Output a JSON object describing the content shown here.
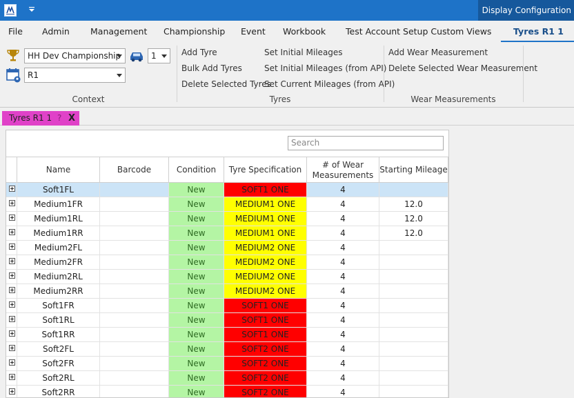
{
  "titlebar": {
    "display_config": "Display Configuration"
  },
  "menu": {
    "tabs": [
      {
        "label": "File"
      },
      {
        "label": "Admin"
      },
      {
        "label": "Management"
      },
      {
        "label": "Championship"
      },
      {
        "label": "Event"
      },
      {
        "label": "Workbook"
      },
      {
        "label": "Test Account Setup Custom Views"
      },
      {
        "label": "Tyres R1 1",
        "active": true
      }
    ]
  },
  "context": {
    "championship": "HH Dev Championship",
    "car": "1",
    "event": "R1",
    "group_label": "Context"
  },
  "tyres_group": {
    "col1": [
      "Add Tyre",
      "Bulk Add Tyres",
      "Delete Selected Tyres"
    ],
    "col2": [
      "Set Initial Mileages",
      "Set Initial Mileages (from API)",
      "Set Current Mileages (from API)"
    ],
    "group_label": "Tyres"
  },
  "wear_group": {
    "items": [
      "Add Wear Measurement",
      "Delete Selected Wear Measurement"
    ],
    "group_label": "Wear Measurements"
  },
  "doc_tab": {
    "title": "Tyres R1 1",
    "help": "?",
    "close": "X"
  },
  "grid": {
    "search_placeholder": "Search",
    "columns": [
      "Name",
      "Barcode",
      "Condition",
      "Tyre Specification",
      "# of Wear Measurements",
      "Starting Mileage"
    ],
    "rows": [
      {
        "name": "Soft1FL",
        "barcode": "",
        "condition": "New",
        "spec": "SOFT1 ONE",
        "spec_type": "soft",
        "wear": "4",
        "mileage": "",
        "selected": true
      },
      {
        "name": "Medium1FR",
        "barcode": "",
        "condition": "New",
        "spec": "MEDIUM1 ONE",
        "spec_type": "medium",
        "wear": "4",
        "mileage": "12.0"
      },
      {
        "name": "Medium1RL",
        "barcode": "",
        "condition": "New",
        "spec": "MEDIUM1 ONE",
        "spec_type": "medium",
        "wear": "4",
        "mileage": "12.0"
      },
      {
        "name": "Medium1RR",
        "barcode": "",
        "condition": "New",
        "spec": "MEDIUM1 ONE",
        "spec_type": "medium",
        "wear": "4",
        "mileage": "12.0"
      },
      {
        "name": "Medium2FL",
        "barcode": "",
        "condition": "New",
        "spec": "MEDIUM2 ONE",
        "spec_type": "medium",
        "wear": "4",
        "mileage": ""
      },
      {
        "name": "Medium2FR",
        "barcode": "",
        "condition": "New",
        "spec": "MEDIUM2 ONE",
        "spec_type": "medium",
        "wear": "4",
        "mileage": ""
      },
      {
        "name": "Medium2RL",
        "barcode": "",
        "condition": "New",
        "spec": "MEDIUM2 ONE",
        "spec_type": "medium",
        "wear": "4",
        "mileage": ""
      },
      {
        "name": "Medium2RR",
        "barcode": "",
        "condition": "New",
        "spec": "MEDIUM2 ONE",
        "spec_type": "medium",
        "wear": "4",
        "mileage": ""
      },
      {
        "name": "Soft1FR",
        "barcode": "",
        "condition": "New",
        "spec": "SOFT1 ONE",
        "spec_type": "soft",
        "wear": "4",
        "mileage": ""
      },
      {
        "name": "Soft1RL",
        "barcode": "",
        "condition": "New",
        "spec": "SOFT1 ONE",
        "spec_type": "soft",
        "wear": "4",
        "mileage": ""
      },
      {
        "name": "Soft1RR",
        "barcode": "",
        "condition": "New",
        "spec": "SOFT1 ONE",
        "spec_type": "soft",
        "wear": "4",
        "mileage": ""
      },
      {
        "name": "Soft2FL",
        "barcode": "",
        "condition": "New",
        "spec": "SOFT2 ONE",
        "spec_type": "soft",
        "wear": "4",
        "mileage": ""
      },
      {
        "name": "Soft2FR",
        "barcode": "",
        "condition": "New",
        "spec": "SOFT2 ONE",
        "spec_type": "soft",
        "wear": "4",
        "mileage": ""
      },
      {
        "name": "Soft2RL",
        "barcode": "",
        "condition": "New",
        "spec": "SOFT2 ONE",
        "spec_type": "soft",
        "wear": "4",
        "mileage": ""
      },
      {
        "name": "Soft2RR",
        "barcode": "",
        "condition": "New",
        "spec": "SOFT2 ONE",
        "spec_type": "soft",
        "wear": "4",
        "mileage": ""
      }
    ]
  },
  "colors": {
    "titlebar": "#1e73c8",
    "condition_new": "#b4f5a4",
    "spec_soft": "#ff0000",
    "spec_medium": "#ffff00",
    "selected_row": "#cce4f7",
    "doc_tab": "#e042c8"
  },
  "icons": [
    "app-logo-icon",
    "quick-access-dropdown-icon",
    "trophy-icon",
    "car-icon",
    "calendar-pin-icon",
    "expand-row-icon"
  ]
}
